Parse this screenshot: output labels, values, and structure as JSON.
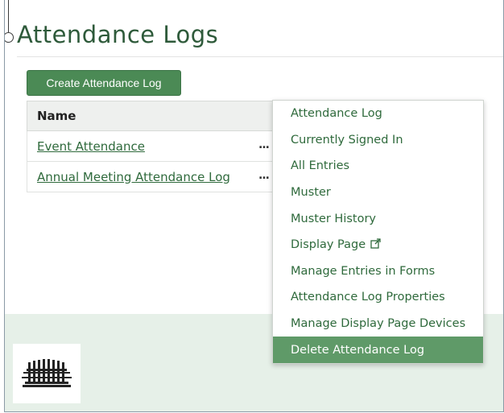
{
  "page": {
    "title": "Attendance Logs"
  },
  "toolbar": {
    "create_label": "Create Attendance Log"
  },
  "table": {
    "header": "Name",
    "rows": [
      {
        "name": "Event Attendance",
        "actions": "..."
      },
      {
        "name": "Annual Meeting Attendance Log",
        "actions": "..."
      }
    ]
  },
  "context_menu": {
    "items": [
      {
        "label": "Attendance Log"
      },
      {
        "label": "Currently Signed In"
      },
      {
        "label": "All Entries"
      },
      {
        "label": "Muster"
      },
      {
        "label": "Muster History"
      },
      {
        "label": "Display Page",
        "icon": "external-link-icon"
      },
      {
        "label": "Manage Entries in Forms"
      },
      {
        "label": "Attendance Log Properties"
      },
      {
        "label": "Manage Display Page Devices"
      },
      {
        "label": "Delete Attendance Log",
        "active": true
      }
    ]
  },
  "colors": {
    "accent": "#4b8a55",
    "link": "#2f6a3c",
    "highlight": "#5f9a68",
    "footer": "#e6f0e8"
  }
}
